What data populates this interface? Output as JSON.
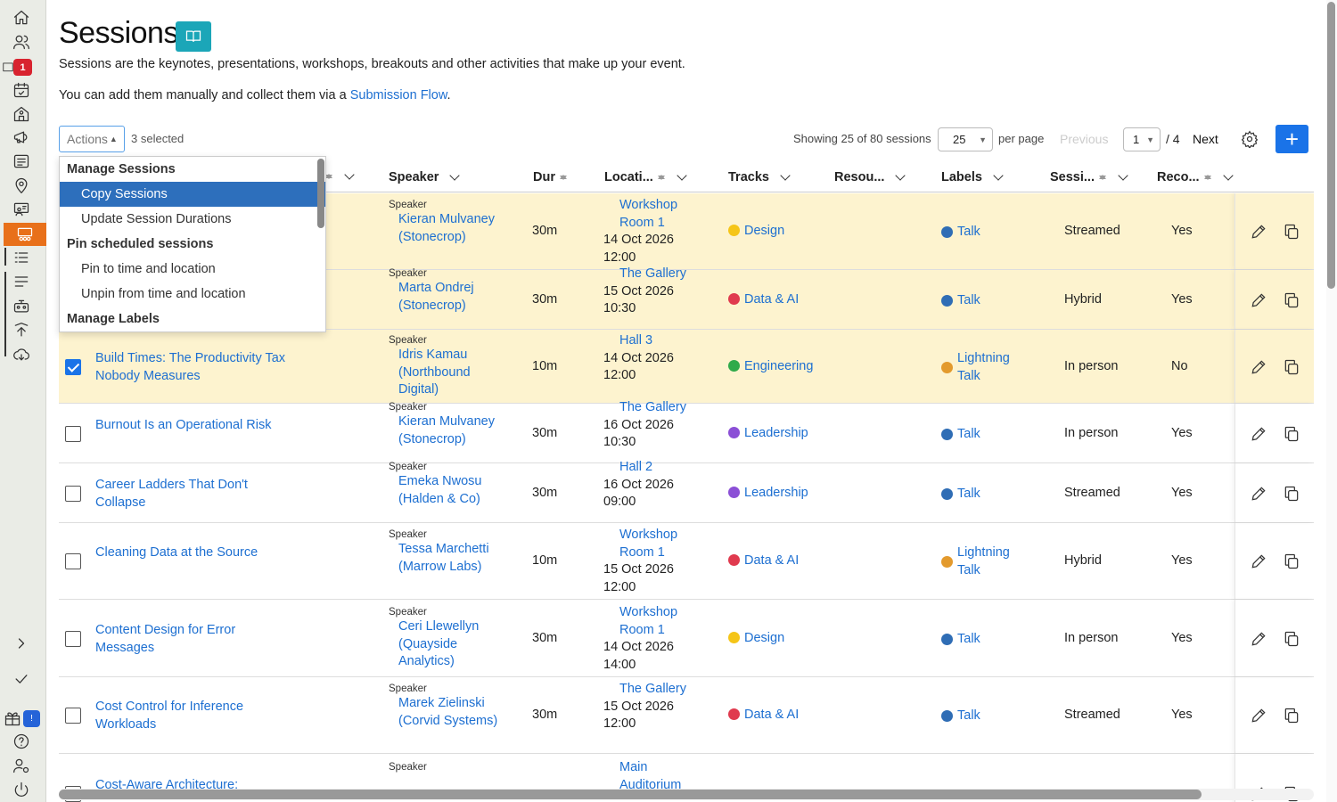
{
  "sidebar": {
    "notification_badge": "1",
    "gift_badge": "!",
    "items": [
      "home-icon",
      "people-icon",
      "inbox-icon",
      "calendar-icon",
      "venue-icon",
      "megaphone-icon",
      "list-icon",
      "location-icon",
      "speaker-icon",
      "sessions-icon",
      "checklist-icon",
      "menu-icon",
      "robot-icon",
      "upload-icon",
      "download-icon",
      "expand-icon",
      "check-icon",
      "gift-icon",
      "help-icon",
      "user-settings-icon",
      "power-icon"
    ]
  },
  "page": {
    "title": "Sessions",
    "description": "Sessions are the keynotes, presentations, workshops, breakouts and other activities that make up your event.",
    "description2_prefix": "You can add them manually and collect them via a ",
    "submission_link": "Submission Flow",
    "description2_suffix": "."
  },
  "toolbar": {
    "actions_label": "Actions",
    "selected_count": "3 selected",
    "showing": "Showing 25 of 80 sessions",
    "per_page_value": "25",
    "per_page_label": "per page",
    "previous": "Previous",
    "page_value": "1",
    "page_of": "/ 4",
    "next": "Next"
  },
  "actions_menu": {
    "groups": [
      {
        "label": "Manage Sessions",
        "items": [
          "Copy Sessions",
          "Update Session Durations"
        ]
      },
      {
        "label": "Pin scheduled sessions",
        "items": [
          "Pin to time and location",
          "Unpin from time and location"
        ]
      },
      {
        "label": "Manage Labels",
        "items": []
      }
    ],
    "highlighted": "Copy Sessions"
  },
  "table": {
    "columns": {
      "speaker": "Speaker",
      "duration": "Dur",
      "location": "Locati...",
      "tracks": "Tracks",
      "resources": "Resou...",
      "labels": "Labels",
      "session_type": "Sessi...",
      "recorded": "Reco..."
    },
    "rows": [
      {
        "selected": true,
        "title": "",
        "speaker_label": "Speaker",
        "speaker": "Kieran Mulvaney (Stonecrop)",
        "duration": "30m",
        "location": "Workshop Room 1",
        "datetime": "14 Oct 2026 12:00",
        "track": "Design",
        "track_color": "#f5c518",
        "label": "Talk",
        "label_color": "#2f6db5",
        "session": "Streamed",
        "recorded": "Yes"
      },
      {
        "selected": true,
        "title": "",
        "speaker_label": "Speaker",
        "speaker": "Marta Ondrej (Stonecrop)",
        "duration": "30m",
        "location": "The Gallery",
        "datetime": "15 Oct 2026 10:30",
        "track": "Data & AI",
        "track_color": "#e03a4e",
        "label": "Talk",
        "label_color": "#2f6db5",
        "session": "Hybrid",
        "recorded": "Yes"
      },
      {
        "selected": true,
        "title": "Build Times: The Productivity Tax Nobody Measures",
        "speaker_label": "Speaker",
        "speaker": "Idris Kamau (Northbound Digital)",
        "duration": "10m",
        "location": "Hall 3",
        "datetime": "14 Oct 2026 12:00",
        "track": "Engineering",
        "track_color": "#2faa4a",
        "label": "Lightning Talk",
        "label_color": "#e39a2d",
        "session": "In person",
        "recorded": "No"
      },
      {
        "selected": false,
        "title": "Burnout Is an Operational Risk",
        "speaker_label": "Speaker",
        "speaker": "Kieran Mulvaney (Stonecrop)",
        "duration": "30m",
        "location": "The Gallery",
        "datetime": "16 Oct 2026 10:30",
        "track": "Leadership",
        "track_color": "#8b4fd6",
        "label": "Talk",
        "label_color": "#2f6db5",
        "session": "In person",
        "recorded": "Yes"
      },
      {
        "selected": false,
        "title": "Career Ladders That Don't Collapse",
        "speaker_label": "Speaker",
        "speaker": "Emeka Nwosu (Halden & Co)",
        "duration": "30m",
        "location": "Hall 2",
        "datetime": "16 Oct 2026 09:00",
        "track": "Leadership",
        "track_color": "#8b4fd6",
        "label": "Talk",
        "label_color": "#2f6db5",
        "session": "Streamed",
        "recorded": "Yes"
      },
      {
        "selected": false,
        "title": "Cleaning Data at the Source",
        "speaker_label": "Speaker",
        "speaker": "Tessa Marchetti (Marrow Labs)",
        "duration": "10m",
        "location": "Workshop Room 1",
        "datetime": "15 Oct 2026 12:00",
        "track": "Data & AI",
        "track_color": "#e03a4e",
        "label": "Lightning Talk",
        "label_color": "#e39a2d",
        "session": "Hybrid",
        "recorded": "Yes"
      },
      {
        "selected": false,
        "title": "Content Design for Error Messages",
        "speaker_label": "Speaker",
        "speaker": "Ceri Llewellyn (Quayside Analytics)",
        "duration": "30m",
        "location": "Workshop Room 1",
        "datetime": "14 Oct 2026 14:00",
        "track": "Design",
        "track_color": "#f5c518",
        "label": "Talk",
        "label_color": "#2f6db5",
        "session": "In person",
        "recorded": "Yes"
      },
      {
        "selected": false,
        "title": "Cost Control for Inference Workloads",
        "speaker_label": "Speaker",
        "speaker": "Marek Zielinski (Corvid Systems)",
        "duration": "30m",
        "location": "The Gallery",
        "datetime": "15 Oct 2026 12:00",
        "track": "Data & AI",
        "track_color": "#e03a4e",
        "label": "Talk",
        "label_color": "#2f6db5",
        "session": "Streamed",
        "recorded": "Yes"
      },
      {
        "selected": false,
        "title": "Cost-Aware Architecture:",
        "speaker_label": "Speaker",
        "speaker": "",
        "duration": "",
        "location": "Main Auditorium",
        "datetime": "",
        "track": "",
        "track_color": "#2f6db5",
        "label": "",
        "label_color": "#2f6db5",
        "session": "",
        "recorded": ""
      }
    ]
  }
}
